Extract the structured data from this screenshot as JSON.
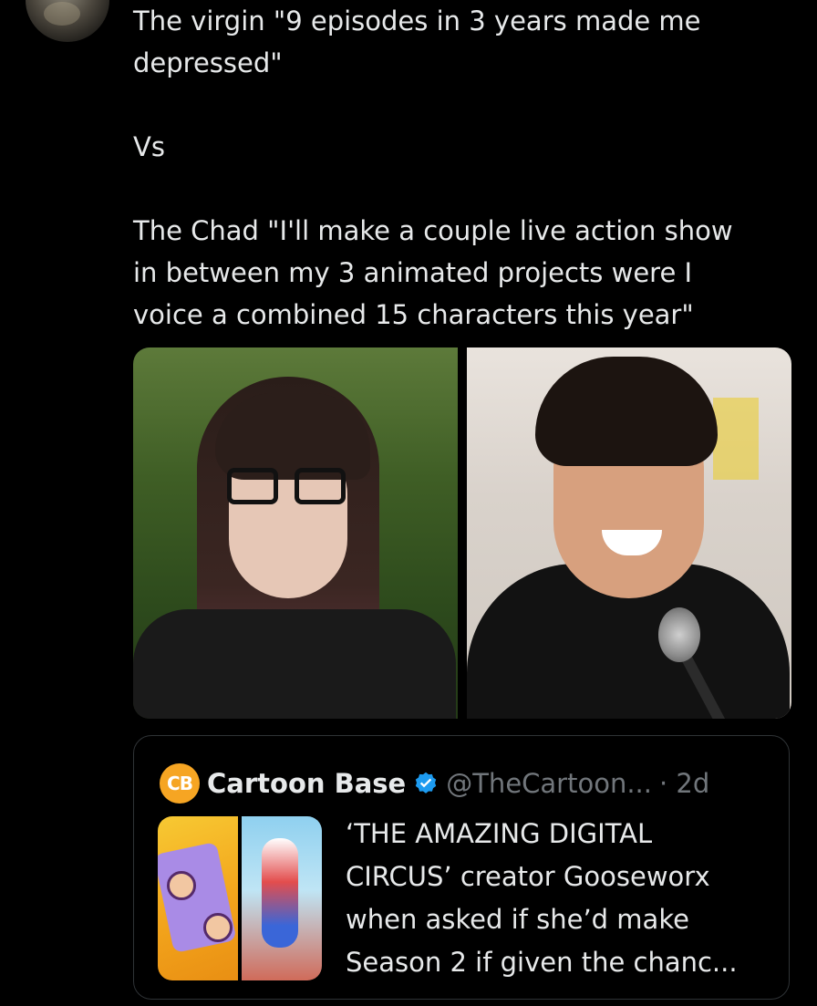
{
  "tweet": {
    "text": "The virgin \"9 episodes in 3 years made me\ndepressed\"\n\nVs\n\nThe Chad \"I'll make a couple live action show\nin between my 3 animated projects were I\nvoice a combined 15 characters this year\""
  },
  "media": {
    "images": [
      "woman-with-glasses-photo",
      "smiling-man-with-microphone-photo"
    ]
  },
  "quoted_tweet": {
    "logo_text": "CB",
    "author_name": "Cartoon Base",
    "handle": "@TheCartoon...",
    "time": "· 2d",
    "text": "‘THE AMAZING DIGITAL\nCIRCUS’ creator Gooseworx\nwhen asked if she’d make\nSeason 2 if given the chanc...",
    "verified_color": "#1d9bf0"
  },
  "colors": {
    "background": "#000000",
    "text_primary": "#e7e9ea",
    "text_secondary": "#71767b",
    "border": "#2f3336",
    "logo_bg": "#f6a523"
  }
}
